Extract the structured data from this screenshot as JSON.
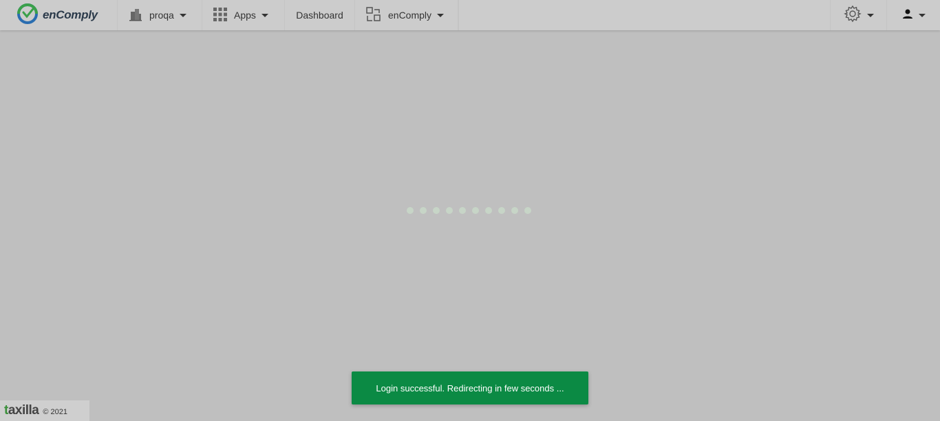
{
  "app": {
    "logo_text": "enComply"
  },
  "header": {
    "org_label": "proqa",
    "apps_label": "Apps",
    "dashboard_label": "Dashboard",
    "product_label": "enComply"
  },
  "icons": {
    "logo": "encomply-logo-icon",
    "org": "building-icon",
    "apps": "grid-icon",
    "product": "switch-app-icon",
    "settings": "gear-icon",
    "user": "user-icon"
  },
  "loader": {
    "dot_count": 10
  },
  "toast": {
    "message": "Login successful. Redirecting in few seconds ..."
  },
  "footer": {
    "brand": "axilla",
    "brand_prefix": "t",
    "copyright": "© 2021"
  },
  "colors": {
    "toast_bg": "#0b8a44",
    "overlay_bg": "#bfbfbf",
    "topbar_bg": "#cccccc",
    "logo_green": "#3aa04a",
    "logo_blue": "#2a6db0"
  }
}
